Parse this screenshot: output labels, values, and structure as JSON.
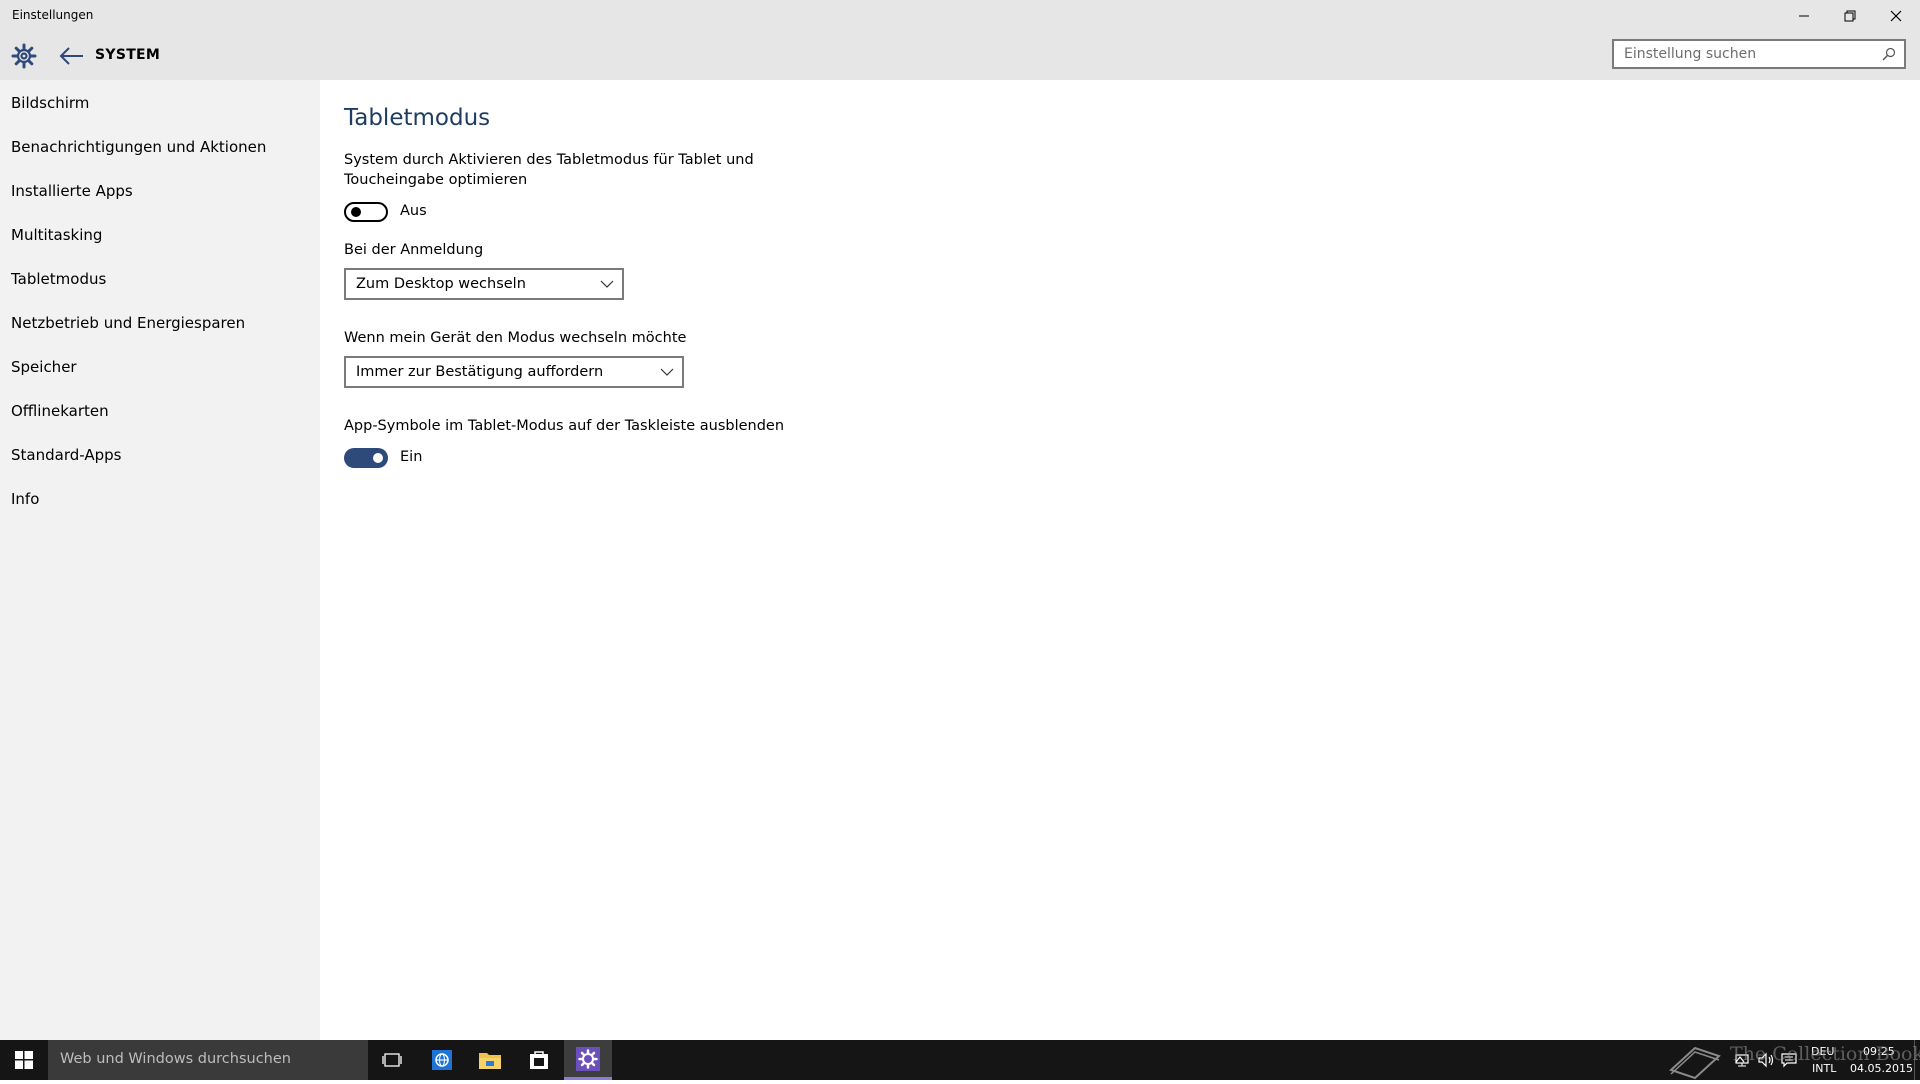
{
  "window": {
    "title": "Einstellungen",
    "controls": {
      "minimize": "minimize",
      "restore": "restore",
      "close": "close"
    }
  },
  "header": {
    "section": "SYSTEM",
    "search_placeholder": "Einstellung suchen"
  },
  "sidebar": {
    "items": [
      {
        "label": "Bildschirm"
      },
      {
        "label": "Benachrichtigungen und Aktionen"
      },
      {
        "label": "Installierte Apps"
      },
      {
        "label": "Multitasking"
      },
      {
        "label": "Tabletmodus"
      },
      {
        "label": "Netzbetrieb und Energiesparen"
      },
      {
        "label": "Speicher"
      },
      {
        "label": "Offlinekarten"
      },
      {
        "label": "Standard-Apps"
      },
      {
        "label": "Info"
      }
    ],
    "selected": "Tabletmodus"
  },
  "main": {
    "title": "Tabletmodus",
    "tablet_toggle": {
      "description_line1": "System durch Aktivieren des Tabletmodus für Tablet und",
      "description_line2": "Toucheingabe optimieren",
      "state_label": "Aus",
      "on": false
    },
    "signin": {
      "label": "Bei der Anmeldung",
      "value": "Zum Desktop wechseln"
    },
    "mode_switch": {
      "label": "Wenn mein Gerät den Modus wechseln möchte",
      "value": "Immer zur Bestätigung auffordern"
    },
    "hide_icons": {
      "label": "App-Symbole im Tablet-Modus auf der Taskleiste ausblenden",
      "state_label": "Ein",
      "on": true
    }
  },
  "taskbar": {
    "search_placeholder": "Web und Windows durchsuchen",
    "pinned": [
      "task-view-icon",
      "edge-icon",
      "file-explorer-icon",
      "store-icon",
      "settings-icon"
    ],
    "active": "settings-icon",
    "tray": {
      "lang_top": "DEU",
      "lang_bottom": "INTL",
      "time": "09:25",
      "date": "04.05.2015"
    },
    "watermark": "The Collection Book"
  },
  "colors": {
    "accent": "#2d4a7a",
    "title_color": "#1f3d63",
    "chrome": "#e6e6e6",
    "sidebar": "#f2f2f2",
    "taskbar": "#151515"
  }
}
